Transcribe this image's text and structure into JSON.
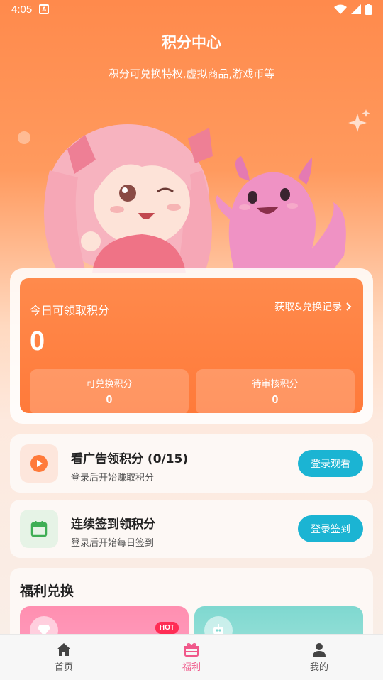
{
  "status": {
    "time": "4:05",
    "app_icon": "A"
  },
  "header": {
    "title": "积分中心",
    "subtitle": "积分可兑换特权,虚拟商品,游戏币等"
  },
  "points": {
    "today_label": "今日可领取积分",
    "record_label": "获取&兑换记录",
    "today_value": "0",
    "exchangeable_label": "可兑换积分",
    "exchangeable_value": "0",
    "pending_label": "待审核积分",
    "pending_value": "0"
  },
  "tasks": {
    "ad": {
      "title": "看广告领积分 (0/15)",
      "desc": "登录后开始赚取积分",
      "button": "登录观看"
    },
    "sign": {
      "title": "连续签到领积分",
      "desc": "登录后开始每日签到",
      "button": "登录签到"
    }
  },
  "welfare": {
    "title": "福利兑换",
    "hot_badge": "HOT"
  },
  "tabs": [
    {
      "label": "首页",
      "icon": "home-icon"
    },
    {
      "label": "福利",
      "icon": "gift-icon"
    },
    {
      "label": "我的",
      "icon": "user-icon"
    }
  ],
  "colors": {
    "accent": "#ff7a3a",
    "button": "#1bb4d3",
    "active_tab": "#f0588a"
  }
}
